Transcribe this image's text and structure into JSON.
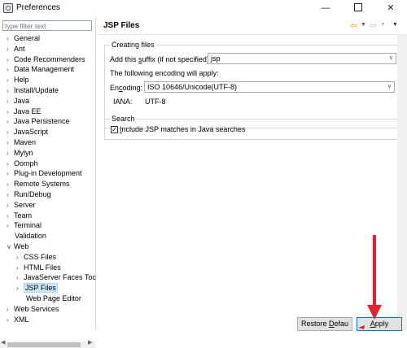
{
  "window": {
    "title": "Preferences",
    "minimize": "—",
    "close": "✕"
  },
  "filter": {
    "placeholder": "type filter text"
  },
  "tree": {
    "items": [
      {
        "label": "General",
        "arrow": "›"
      },
      {
        "label": "Ant",
        "arrow": "›"
      },
      {
        "label": "Code Recommenders",
        "arrow": "›"
      },
      {
        "label": "Data Management",
        "arrow": "›"
      },
      {
        "label": "Help",
        "arrow": "›"
      },
      {
        "label": "Install/Update",
        "arrow": "›"
      },
      {
        "label": "Java",
        "arrow": "›"
      },
      {
        "label": "Java EE",
        "arrow": "›"
      },
      {
        "label": "Java Persistence",
        "arrow": "›"
      },
      {
        "label": "JavaScript",
        "arrow": "›"
      },
      {
        "label": "Maven",
        "arrow": "›"
      },
      {
        "label": "Mylyn",
        "arrow": "›"
      },
      {
        "label": "Oomph",
        "arrow": "›"
      },
      {
        "label": "Plug-in Development",
        "arrow": "›"
      },
      {
        "label": "Remote Systems",
        "arrow": "›"
      },
      {
        "label": "Run/Debug",
        "arrow": "›"
      },
      {
        "label": "Server",
        "arrow": "›"
      },
      {
        "label": "Team",
        "arrow": "›"
      },
      {
        "label": "Terminal",
        "arrow": "›"
      },
      {
        "label": "Validation",
        "arrow": ""
      },
      {
        "label": "Web",
        "arrow": "∨"
      },
      {
        "label": "CSS Files",
        "arrow": "›"
      },
      {
        "label": "HTML Files",
        "arrow": "›"
      },
      {
        "label": "JavaServer Faces Toc",
        "arrow": "›"
      },
      {
        "label": "JSP Files",
        "arrow": "›"
      },
      {
        "label": "Web Page Editor",
        "arrow": ""
      },
      {
        "label": "Web Services",
        "arrow": "›"
      },
      {
        "label": "XML",
        "arrow": "›"
      }
    ]
  },
  "page": {
    "title": "JSP Files",
    "creating_files": {
      "group_title": "Creating files",
      "suffix_label_pre": "Add this ",
      "suffix_label_mnemonic": "s",
      "suffix_label_post": "uffix (if not specified):",
      "suffix_value": "jsp",
      "encoding_info": "The following encoding will apply:",
      "encoding_label_pre": "En",
      "encoding_label_mnemonic": "c",
      "encoding_label_post": "oding:",
      "encoding_value": "ISO 10646/Unicode(UTF-8)",
      "iana_label": "IANA:",
      "iana_value": "UTF-8"
    },
    "search": {
      "group_title": "Search",
      "checkbox_mark": "✓",
      "checkbox_mnemonic": "I",
      "checkbox_label": "nclude JSP matches in Java searches",
      "checked": true
    }
  },
  "buttons": {
    "restore_pre": "Restore ",
    "restore_mnemonic": "D",
    "restore_post": "efau",
    "apply_mnemonic": "A",
    "apply_post": "pply"
  },
  "colors": {
    "annotation_arrow": "#e8202a",
    "selection": "#cce8ff",
    "nav_back": "#e1a21b"
  }
}
